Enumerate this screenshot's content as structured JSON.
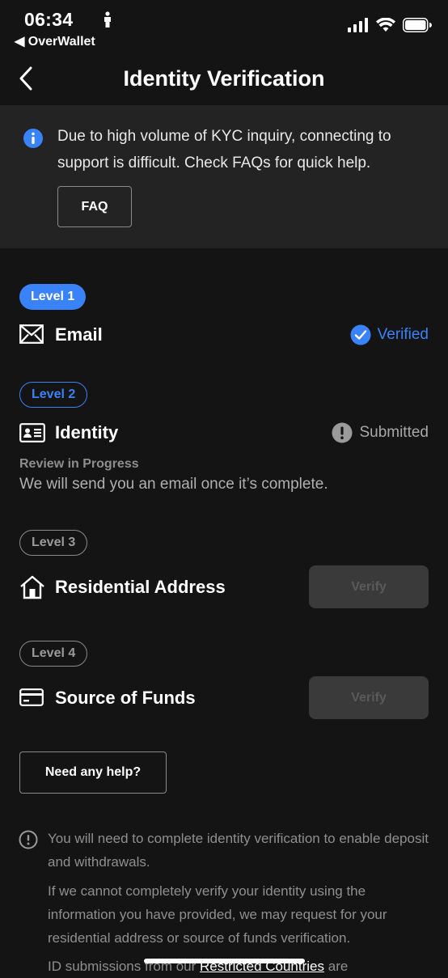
{
  "status_bar": {
    "time": "06:34",
    "back_app": "◀ OverWallet"
  },
  "header": {
    "title": "Identity Verification"
  },
  "notice": {
    "text": "Due to high volume of KYC inquiry, connecting to support is difficult. Check FAQs for quick help.",
    "faq_label": "FAQ"
  },
  "levels": [
    {
      "badge": "Level 1",
      "label": "Email",
      "status": "Verified"
    },
    {
      "badge": "Level 2",
      "label": "Identity",
      "status": "Submitted",
      "review_title": "Review in Progress",
      "review_sub": "We will send you an email once it’s complete."
    },
    {
      "badge": "Level 3",
      "label": "Residential Address",
      "action": "Verify"
    },
    {
      "badge": "Level 4",
      "label": "Source of Funds",
      "action": "Verify"
    }
  ],
  "help_label": "Need any help?",
  "fine_print": {
    "p1": "You will need to complete identity verification to enable deposit and withdrawals.",
    "p2": "If we cannot completely verify your identity using the information you have provided, we may request for your residential address or source of funds verification.",
    "p3_before": "ID submissions from our ",
    "p3_link": "Restricted Countries",
    "p3_after": " are"
  },
  "colors": {
    "accent": "#3a82f7",
    "background": "#141414",
    "notice_bg": "#232323"
  }
}
